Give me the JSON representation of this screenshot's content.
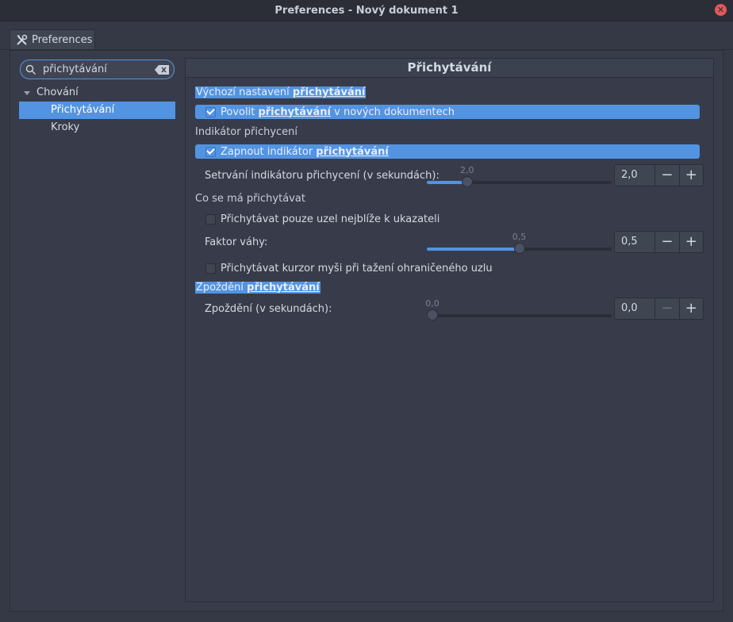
{
  "window": {
    "title": "Preferences - Nový dokument 1"
  },
  "tab": {
    "label": "Preferences"
  },
  "search": {
    "value": "přichytávání"
  },
  "tree": {
    "parent": "Chování",
    "items": [
      "Přichytávání",
      "Kroky"
    ]
  },
  "panel": {
    "title": "Přichytávání",
    "section1": {
      "prefix": "Výchozí nastavení ",
      "term": "přichytávání"
    },
    "check1": {
      "prefix": "Povolit ",
      "term": "přichytávání",
      "suffix": " v nových dokumentech",
      "checked": true
    },
    "section2": {
      "label": "Indikátor přichycení"
    },
    "check2": {
      "prefix": "Zapnout indikátor ",
      "term": "přichytávání",
      "checked": true
    },
    "slider1": {
      "label": "Setrvání indikátoru přichycení (v sekundách):",
      "value_label": "2,0",
      "spin_value": "2,0",
      "fraction": 0.2
    },
    "section3": {
      "label": "Co se má přichytávat"
    },
    "check3": {
      "label": "Přichytávat pouze uzel nejblíže k ukazateli",
      "checked": false
    },
    "slider2": {
      "label": "Faktor váhy:",
      "value_label": "0,5",
      "spin_value": "0,5",
      "fraction": 0.5
    },
    "check4": {
      "label": "Přichytávat kurzor myši při tažení ohraničeného uzlu",
      "checked": false
    },
    "section4": {
      "prefix": "Zpoždění ",
      "term": "přichytávání"
    },
    "slider3": {
      "label": "Zpoždění (v sekundách):",
      "value_label": "0,0",
      "spin_value": "0,0",
      "fraction": 0.0
    },
    "spin_minus": "−",
    "spin_plus": "+"
  },
  "colors": {
    "accent": "#5294e2",
    "background": "#383c4a"
  }
}
